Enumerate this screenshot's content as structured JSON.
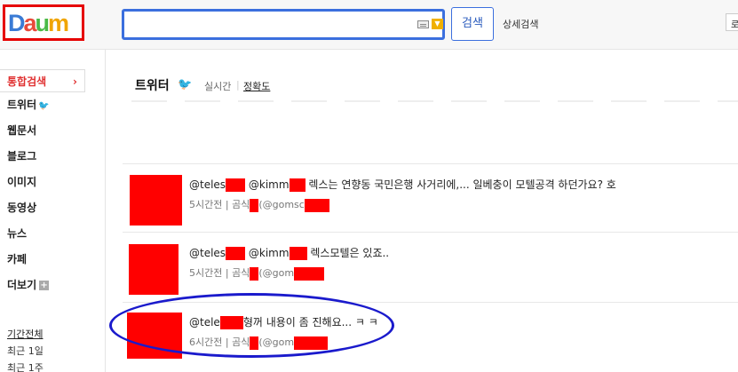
{
  "header": {
    "logo_text": [
      "D",
      "a",
      "u",
      "m"
    ],
    "search_placeholder": "",
    "search_button_label": "검색",
    "detail_search_label": "상세검색",
    "right_cut_label": "로"
  },
  "sidebar": {
    "items": [
      {
        "label": "통합검색",
        "active": true
      },
      {
        "label": "트위터",
        "icon": "twitter-bird-icon"
      },
      {
        "label": "웹문서"
      },
      {
        "label": "블로그"
      },
      {
        "label": "이미지"
      },
      {
        "label": "동영상"
      },
      {
        "label": "뉴스"
      },
      {
        "label": "카페"
      },
      {
        "label": "더보기",
        "icon": "plus-icon"
      }
    ],
    "periods": [
      {
        "label": "기간전체",
        "selected": true
      },
      {
        "label": "최근 1일"
      },
      {
        "label": "최근 1주"
      }
    ]
  },
  "main": {
    "title": "트위터",
    "tabs": [
      {
        "label": "실시간"
      },
      {
        "label": "정확도",
        "selected": true
      }
    ],
    "tweets": [
      {
        "handle_prefix": "@teles",
        "mention_prefix": "@kimm",
        "text": "렉스는 연향동 국민은행 사거리에,... 일베충이 모텔공격 하던가요? 호",
        "time": "5시간전",
        "author_prefix": "곰식",
        "author_handle_prefix": "(@gomsc"
      },
      {
        "handle_prefix": "@teles",
        "mention_prefix": "@kimm",
        "text": "렉스모텔은 있죠..",
        "time": "5시간전",
        "author_prefix": "곰식",
        "author_handle_prefix": "(@gom"
      },
      {
        "handle_prefix": "@tele",
        "mention_prefix": "",
        "text": "형꺼 내용이 좀 진해요... ㅋ ㅋ",
        "time": "6시간전",
        "author_prefix": "곰식",
        "author_handle_prefix": "(@gom"
      }
    ]
  },
  "colors": {
    "accent_blue": "#3b6fde",
    "redaction": "#ff0000",
    "annotation_circle": "#1a1acc",
    "active_red": "#e03030"
  }
}
